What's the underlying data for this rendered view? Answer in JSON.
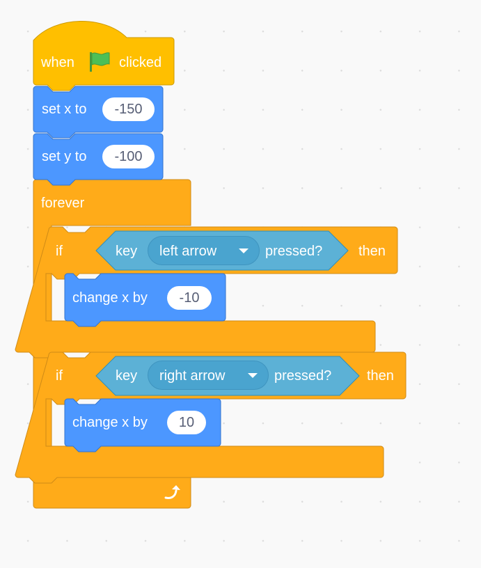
{
  "workspace": {
    "background": "#f9f9f9",
    "grid_dot_color": "#dcdcdc"
  },
  "colors": {
    "events": "#ffbf00",
    "motion": "#4c97ff",
    "control": "#ffab19",
    "sensing": "#5cb1d6",
    "sensing_dropdown": "#4aa4cf",
    "text_on_block": "#ffffff",
    "input_text": "#575e75",
    "flag": "#4cbf56"
  },
  "script": {
    "hat": {
      "label_before": "when",
      "icon": "green-flag-icon",
      "label_after": "clicked"
    },
    "set_x": {
      "label": "set x to",
      "value": "-150"
    },
    "set_y": {
      "label": "set y to",
      "value": "-100"
    },
    "forever": {
      "label": "forever",
      "loop_icon": "loop-arrow-icon"
    },
    "if_blocks": [
      {
        "label_if": "if",
        "label_then": "then",
        "condition": {
          "label_key": "key",
          "key": "left arrow",
          "label_pressed": "pressed?"
        },
        "body": {
          "label": "change x by",
          "value": "-10"
        }
      },
      {
        "label_if": "if",
        "label_then": "then",
        "condition": {
          "label_key": "key",
          "key": "right arrow",
          "label_pressed": "pressed?"
        },
        "body": {
          "label": "change x by",
          "value": "10"
        }
      }
    ]
  }
}
